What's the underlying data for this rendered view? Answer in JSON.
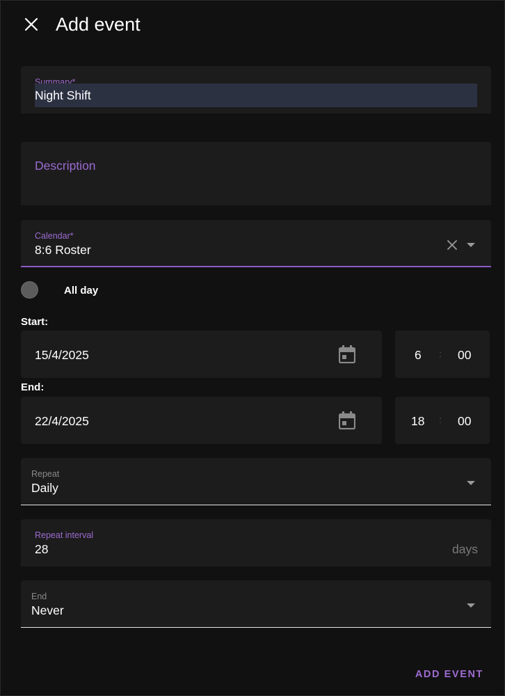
{
  "dialog": {
    "title": "Add event",
    "close_icon": "close-icon"
  },
  "summary": {
    "label": "Summary*",
    "value": "Night Shift"
  },
  "description": {
    "label": "Description",
    "value": ""
  },
  "calendar": {
    "label": "Calendar*",
    "value": "8:6 Roster",
    "clear_icon": "clear-icon",
    "dropdown_icon": "dropdown-arrow-icon"
  },
  "all_day": {
    "label": "All day",
    "checked": false
  },
  "start": {
    "label": "Start:",
    "date": "15/4/2025",
    "hour": "6",
    "separator": ":",
    "minute": "00"
  },
  "end": {
    "label": "End:",
    "date": "22/4/2025",
    "hour": "18",
    "separator": ":",
    "minute": "00"
  },
  "repeat": {
    "label": "Repeat",
    "value": "Daily"
  },
  "repeat_interval": {
    "label": "Repeat interval",
    "value": "28",
    "suffix": "days"
  },
  "repeat_end": {
    "label": "End",
    "value": "Never"
  },
  "actions": {
    "add_label": "ADD EVENT"
  },
  "colors": {
    "background": "#111111",
    "field": "#1c1c1c",
    "accent": "#9c6bd1",
    "selection": "#2c3142"
  }
}
